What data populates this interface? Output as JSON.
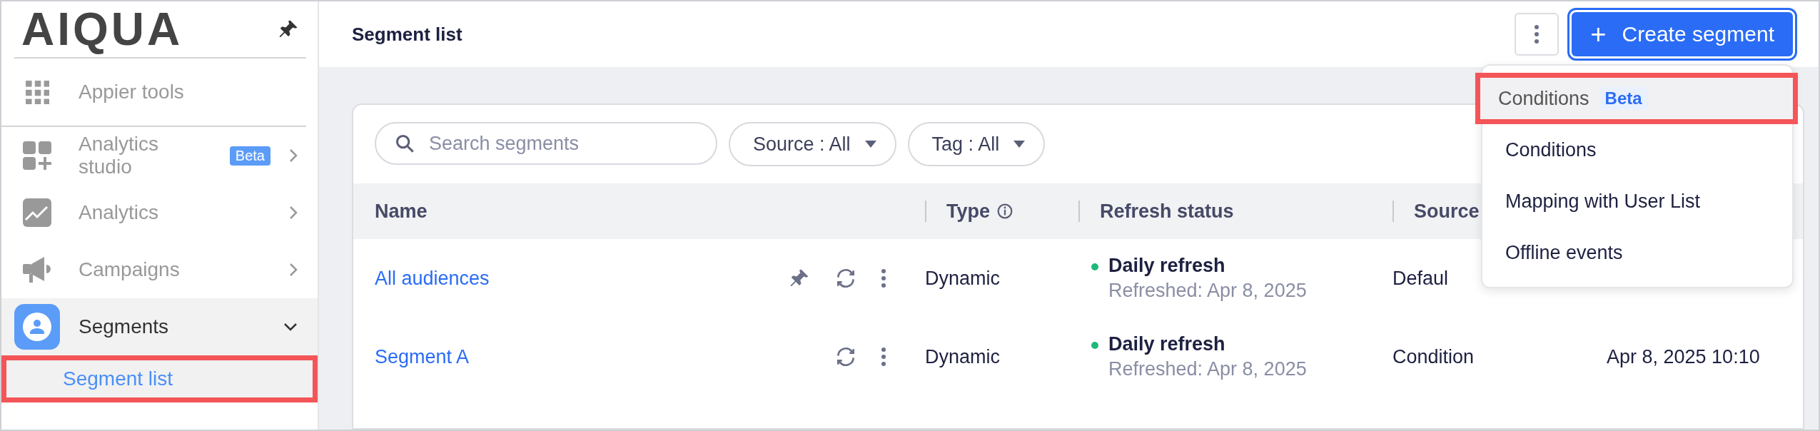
{
  "sidebar": {
    "logo": "AIQUA",
    "items": [
      {
        "label": "Appier tools",
        "selected": false
      },
      {
        "label": "Analytics studio",
        "badge": "Beta",
        "expanded": false,
        "selected": false
      },
      {
        "label": "Analytics",
        "expanded": false,
        "selected": false
      },
      {
        "label": "Campaigns",
        "expanded": false,
        "selected": false
      },
      {
        "label": "Segments",
        "expanded": true,
        "selected": true,
        "children": [
          {
            "label": "Segment list",
            "selected": true,
            "annotated": true
          }
        ]
      }
    ]
  },
  "header": {
    "title": "Segment list",
    "create_button": {
      "icon": "+",
      "label": "Create segment"
    }
  },
  "create_menu": [
    {
      "label": "Conditions",
      "badge": "Beta",
      "selected": true,
      "annotated": true
    },
    {
      "label": "Conditions",
      "selected": false,
      "annotated": false
    },
    {
      "label": "Mapping with User List",
      "selected": false,
      "annotated": false
    },
    {
      "label": "Offline events",
      "selected": false,
      "annotated": false
    }
  ],
  "search": {
    "placeholder": "Search segments"
  },
  "filters": [
    {
      "label": "Source : All"
    },
    {
      "label": "Tag : All"
    }
  ],
  "table": {
    "columns": [
      {
        "label": "Name"
      },
      {
        "label": "Type",
        "info": true
      },
      {
        "label": "Refresh status"
      },
      {
        "label": "Source"
      }
    ],
    "rows": [
      {
        "name": "All audiences",
        "pinned": true,
        "type": "Dynamic",
        "status": "Daily refresh",
        "color": "#1db97a",
        "refreshed": "Refreshed: Apr 8, 2025",
        "source": "Defaul"
      },
      {
        "name": "Segment A",
        "pinned": false,
        "type": "Dynamic",
        "status": "Daily refresh",
        "color": "#1db97a",
        "refreshed": "Refreshed: Apr 8, 2025",
        "source": "Condition",
        "date": "Apr 8, 2025 10:10"
      }
    ]
  }
}
